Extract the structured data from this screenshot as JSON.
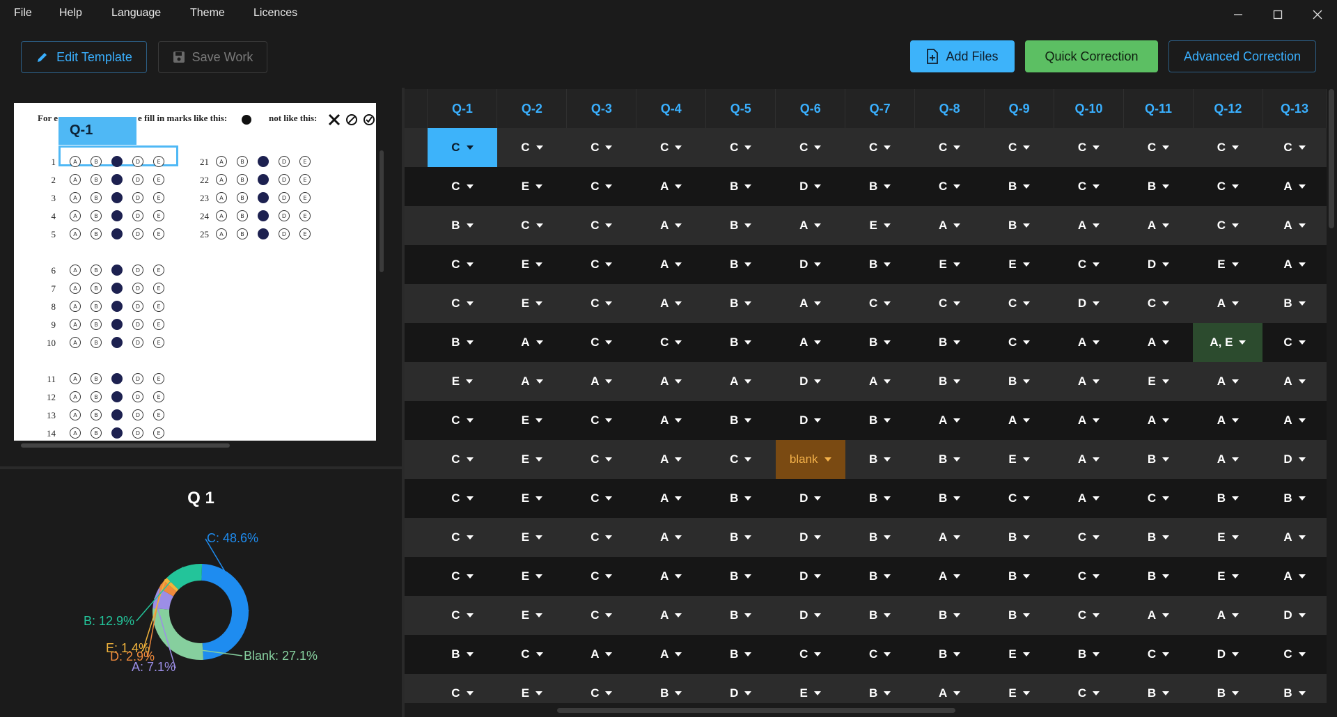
{
  "menu": [
    "File",
    "Help",
    "Language",
    "Theme",
    "Licences"
  ],
  "toolbar": {
    "edit_template": "Edit Template",
    "save_work": "Save Work",
    "add_files": "Add Files",
    "quick_correction": "Quick Correction",
    "advanced_correction": "Advanced Correction"
  },
  "preview": {
    "header_left": "For e",
    "header_mid": "e fill in marks like this:",
    "header_right": "not like this:",
    "selected_question": "Q-1",
    "question_numbers": [
      "1",
      "2",
      "3",
      "4",
      "5",
      "6",
      "7",
      "8",
      "9",
      "10",
      "11",
      "12",
      "13",
      "14",
      "21",
      "22",
      "23",
      "24",
      "25"
    ],
    "bubble_letters": [
      "A",
      "B",
      "C",
      "D",
      "E"
    ]
  },
  "chart": {
    "title": "Q 1"
  },
  "chart_data": {
    "type": "pie",
    "style": "donut",
    "title": "Q 1",
    "slices": [
      {
        "label": "C",
        "value": 48.6,
        "color": "#1e8cf0",
        "text": "C: 48.6%"
      },
      {
        "label": "Blank",
        "value": 27.1,
        "color": "#86cf9e",
        "text": "Blank: 27.1%"
      },
      {
        "label": "A",
        "value": 7.1,
        "color": "#9c8ee6",
        "text": "A: 7.1%"
      },
      {
        "label": "D",
        "value": 2.9,
        "color": "#f08a3c",
        "text": "D: 2.9%"
      },
      {
        "label": "E",
        "value": 1.4,
        "color": "#f2b43c",
        "text": "E: 1.4%"
      },
      {
        "label": "B",
        "value": 12.9,
        "color": "#23c49a",
        "text": "B: 12.9%"
      }
    ]
  },
  "grid": {
    "headers": [
      "Q-1",
      "Q-2",
      "Q-3",
      "Q-4",
      "Q-5",
      "Q-6",
      "Q-7",
      "Q-8",
      "Q-9",
      "Q-10",
      "Q-11",
      "Q-12",
      "Q-13"
    ],
    "rows": [
      [
        "C",
        "C",
        "C",
        "C",
        "C",
        "C",
        "C",
        "C",
        "C",
        "C",
        "C",
        "C",
        "C"
      ],
      [
        "C",
        "E",
        "C",
        "A",
        "B",
        "D",
        "B",
        "C",
        "B",
        "C",
        "B",
        "C",
        "A"
      ],
      [
        "B",
        "C",
        "C",
        "A",
        "B",
        "A",
        "E",
        "A",
        "B",
        "A",
        "A",
        "C",
        "A"
      ],
      [
        "C",
        "E",
        "C",
        "A",
        "B",
        "D",
        "B",
        "E",
        "E",
        "C",
        "D",
        "E",
        "A"
      ],
      [
        "C",
        "E",
        "C",
        "A",
        "B",
        "A",
        "C",
        "C",
        "C",
        "D",
        "C",
        "A",
        "B"
      ],
      [
        "B",
        "A",
        "C",
        "C",
        "B",
        "A",
        "B",
        "B",
        "C",
        "A",
        "A",
        "A, E",
        "C"
      ],
      [
        "E",
        "A",
        "A",
        "A",
        "A",
        "D",
        "A",
        "B",
        "B",
        "A",
        "E",
        "A",
        "A"
      ],
      [
        "C",
        "E",
        "C",
        "A",
        "B",
        "D",
        "B",
        "A",
        "A",
        "A",
        "A",
        "A",
        "A"
      ],
      [
        "C",
        "E",
        "C",
        "A",
        "C",
        "blank",
        "B",
        "B",
        "E",
        "A",
        "B",
        "A",
        "D"
      ],
      [
        "C",
        "E",
        "C",
        "A",
        "B",
        "D",
        "B",
        "B",
        "C",
        "A",
        "C",
        "B",
        "B"
      ],
      [
        "C",
        "E",
        "C",
        "A",
        "B",
        "D",
        "B",
        "A",
        "B",
        "C",
        "B",
        "E",
        "A"
      ],
      [
        "C",
        "E",
        "C",
        "A",
        "B",
        "D",
        "B",
        "A",
        "B",
        "C",
        "B",
        "E",
        "A"
      ],
      [
        "C",
        "E",
        "C",
        "A",
        "B",
        "D",
        "B",
        "B",
        "B",
        "C",
        "A",
        "A",
        "D"
      ],
      [
        "B",
        "C",
        "A",
        "A",
        "B",
        "C",
        "C",
        "B",
        "E",
        "B",
        "C",
        "D",
        "C"
      ],
      [
        "C",
        "E",
        "C",
        "B",
        "D",
        "E",
        "B",
        "A",
        "E",
        "C",
        "B",
        "B",
        "B"
      ]
    ]
  }
}
